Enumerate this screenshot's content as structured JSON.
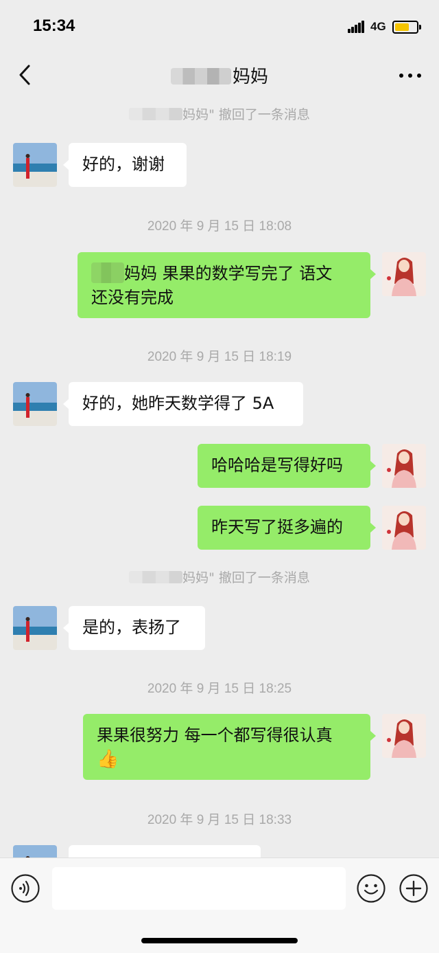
{
  "status_bar": {
    "time": "15:34",
    "network": "4G",
    "battery_level": 0.65,
    "battery_color": "#f5c400"
  },
  "nav": {
    "title_suffix": "妈妈",
    "back_icon": "chevron-left-icon",
    "more_icon": "more-dots-icon"
  },
  "chat": {
    "recall_1": {
      "suffix": "妈妈\" 撤回了一条消息"
    },
    "msg_1": {
      "text": "好的，谢谢"
    },
    "time_1": "2020 年 9 月 15 日 18:08",
    "msg_2": {
      "suffix": "妈妈 果果的数学写完了 语文",
      "line2": "还没有完成"
    },
    "time_2": "2020 年 9 月 15 日 18:19",
    "msg_3": {
      "text": "好的，她昨天数学得了 5A"
    },
    "msg_4": {
      "text": "哈哈哈是写得好吗"
    },
    "msg_5": {
      "text": "昨天写了挺多遍的"
    },
    "recall_2": {
      "suffix": "妈妈\" 撤回了一条消息"
    },
    "msg_6": {
      "text": "是的，表扬了"
    },
    "time_3": "2020 年 9 月 15 日 18:25",
    "msg_7": {
      "text": "果果很努力 每一个都写得很认真",
      "emoji": "👍"
    },
    "time_4": "2020 年 9 月 15 日 18:33"
  },
  "colors": {
    "background": "#ededed",
    "sent_bubble": "#95ec69",
    "received_bubble": "#ffffff",
    "timestamp_text": "#a9a9a9"
  },
  "input_bar": {
    "placeholder": "",
    "voice_icon": "voice-icon",
    "emoji_icon": "emoji-icon",
    "plus_icon": "plus-icon"
  }
}
